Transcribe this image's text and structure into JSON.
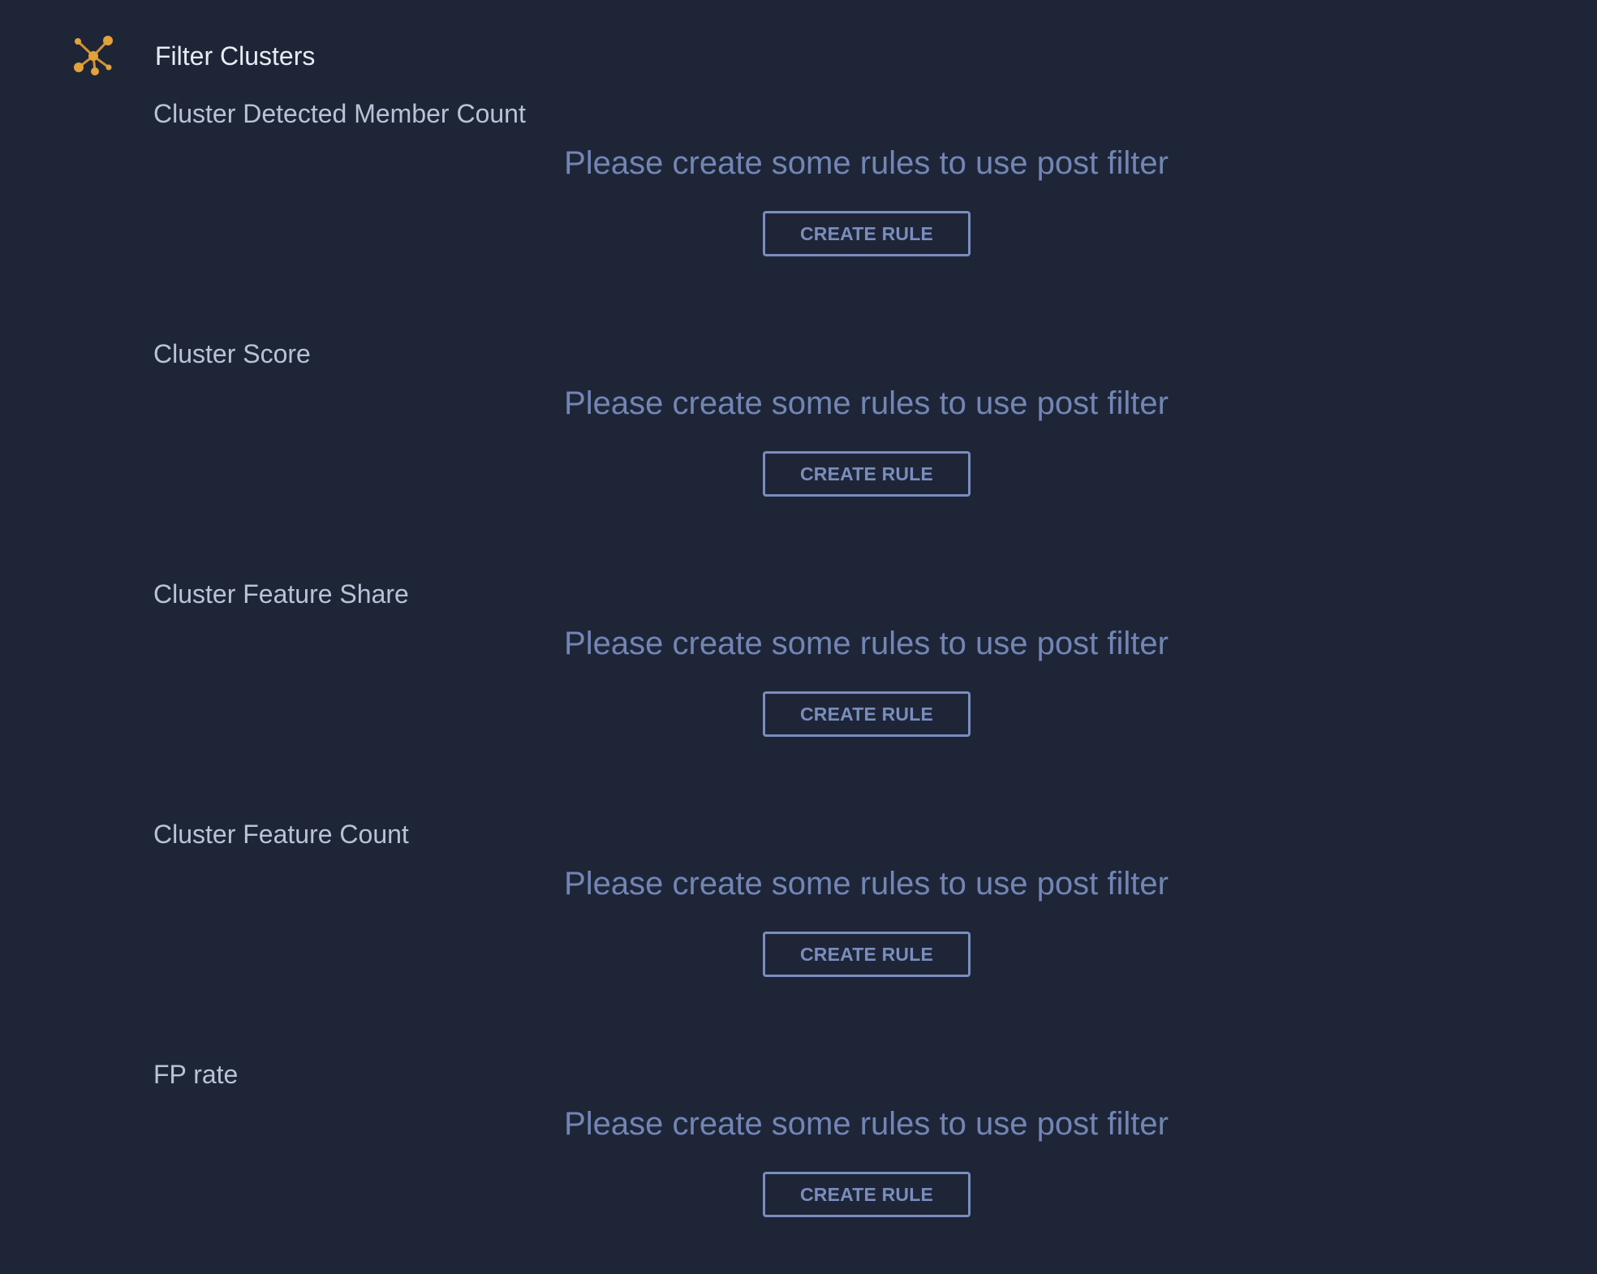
{
  "header": {
    "icon": "cluster-network-icon",
    "title": "Filter Clusters",
    "accent_color": "#e3a23a"
  },
  "sections": [
    {
      "label": "Cluster Detected Member Count",
      "empty_message": "Please create some rules to use post filter",
      "button_label": "CREATE RULE"
    },
    {
      "label": "Cluster Score",
      "empty_message": "Please create some rules to use post filter",
      "button_label": "CREATE RULE"
    },
    {
      "label": "Cluster Feature Share",
      "empty_message": "Please create some rules to use post filter",
      "button_label": "CREATE RULE"
    },
    {
      "label": "Cluster Feature Count",
      "empty_message": "Please create some rules to use post filter",
      "button_label": "CREATE RULE"
    },
    {
      "label": "FP rate",
      "empty_message": "Please create some rules to use post filter",
      "button_label": "CREATE RULE"
    }
  ],
  "colors": {
    "background": "#1e2537",
    "label_text": "#b8c2d8",
    "muted_text": "#7285b5",
    "button_outline": "#7a8dbf"
  }
}
